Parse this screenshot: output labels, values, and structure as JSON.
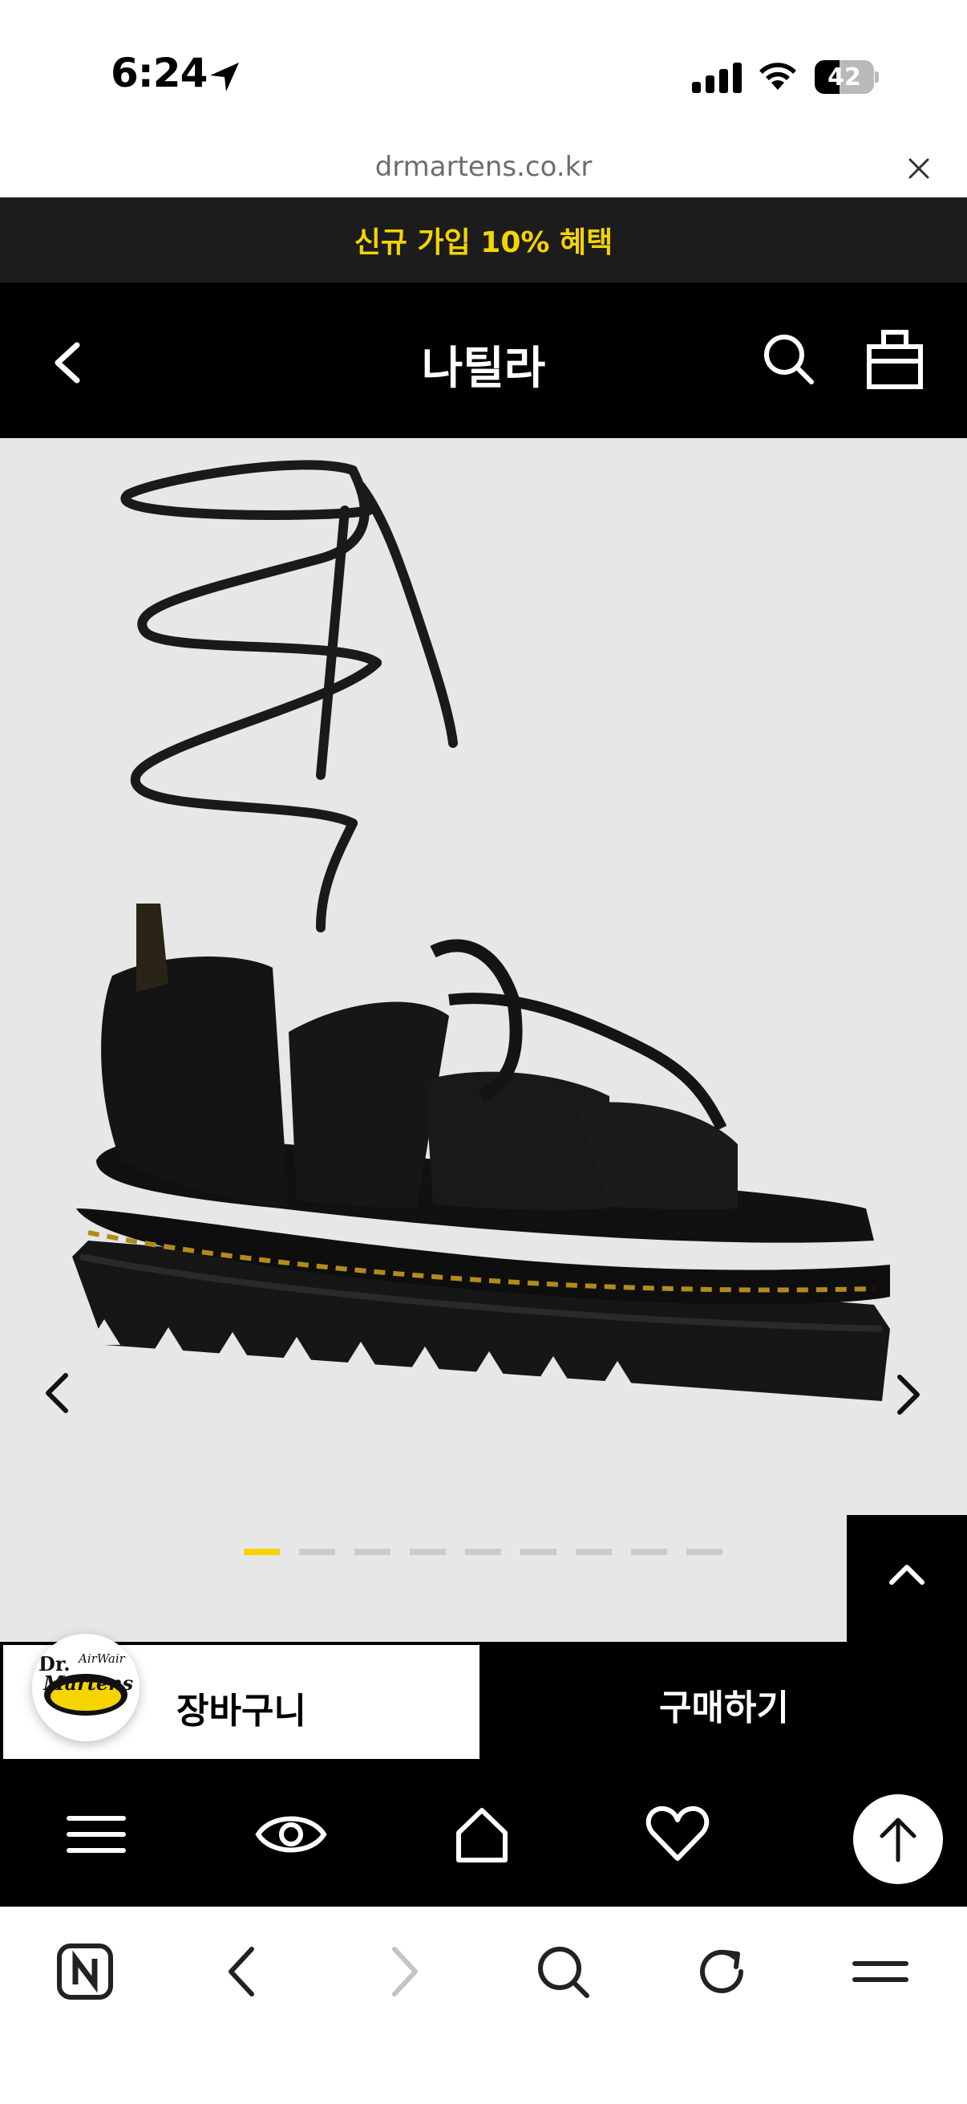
{
  "status_bar": {
    "time": "6:24",
    "battery": "42",
    "battery_level": 0.42
  },
  "browser": {
    "url": "drmartens.co.kr"
  },
  "promo": {
    "text": "신규 가입 10% 혜택"
  },
  "header": {
    "title": "나틸라"
  },
  "gallery": {
    "total_slides": 9,
    "active_slide": 1,
    "accent_color": "#f5d400"
  },
  "cta": {
    "cart_label": "장바구니",
    "buy_label": "구매하기"
  },
  "logo": {
    "line1": "Dr.",
    "line2": "AirWair",
    "line3": "Martens"
  },
  "icons": {
    "header": [
      "back-icon",
      "search-icon",
      "shopping-bag-icon"
    ],
    "site_nav": [
      "menu-icon",
      "eye-icon",
      "home-icon",
      "heart-icon"
    ],
    "toolbar": [
      "naver-icon",
      "back-icon",
      "forward-icon",
      "search-icon",
      "reload-icon",
      "menu-icon"
    ]
  }
}
